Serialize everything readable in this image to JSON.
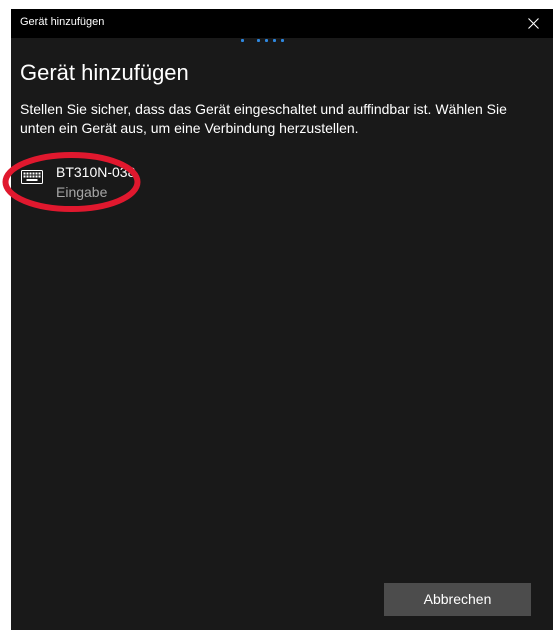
{
  "window": {
    "title": "Gerät hinzufügen"
  },
  "page": {
    "heading": "Gerät hinzufügen",
    "description": "Stellen Sie sicher, dass das Gerät eingeschaltet und auffindbar ist. Wählen Sie unten ein Gerät aus, um eine Verbindung herzustellen."
  },
  "devices": [
    {
      "name": "BT310N-038",
      "type": "Eingabe",
      "icon": "keyboard-icon"
    }
  ],
  "footer": {
    "cancel_label": "Abbrechen"
  },
  "colors": {
    "background": "#191919",
    "titlebar": "#000000",
    "accent": "#2f88e0",
    "annotation": "#e0182e",
    "button": "#4c4c4c"
  }
}
